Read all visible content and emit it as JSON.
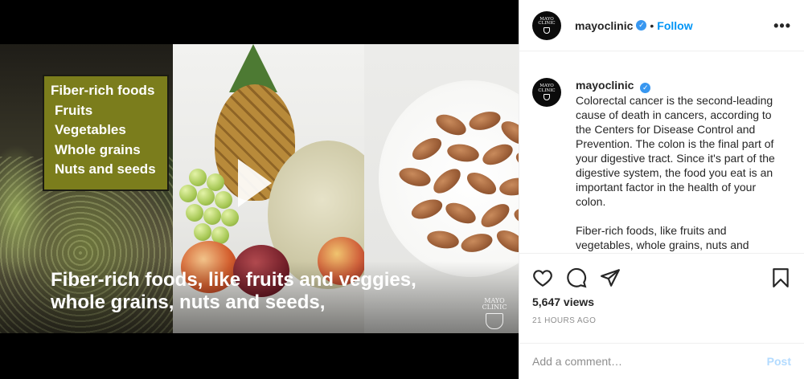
{
  "video": {
    "overlay_list": [
      "Fiber-rich foods",
      "Fruits",
      "Vegetables",
      "Whole grains",
      "Nuts and seeds"
    ],
    "caption_line1": "Fiber-rich foods, like fruits and veggies,",
    "caption_line2": "whole grains, nuts and seeds,",
    "watermark_line1": "MAYO",
    "watermark_line2": "CLINIC"
  },
  "header": {
    "avatar_line1": "MAYO",
    "avatar_line2": "CLINIC",
    "username": "mayoclinic",
    "separator": "•",
    "follow_label": "Follow",
    "more_label": "•••"
  },
  "post": {
    "username": "mayoclinic",
    "caption_p1": "Colorectal cancer is the second-leading cause of death in cancers, according to the Centers for Disease Control and Prevention. The colon is the final part of your digestive tract. Since it's part of the digestive system, the food you eat is an important factor in the health of your colon.",
    "caption_p2": "Fiber-rich foods, like fruits and vegetables, whole grains, nuts and seeds"
  },
  "actions": {
    "views": "5,647 views",
    "timestamp": "21 HOURS AGO"
  },
  "comment_box": {
    "placeholder": "Add a comment…",
    "post_label": "Post"
  },
  "colors": {
    "accent": "#0095f6",
    "verified": "#3897f0",
    "overlay_box": "#7b7d1c"
  },
  "icons": [
    "verified-badge-icon",
    "more-options-icon",
    "heart-icon",
    "comment-icon",
    "share-icon",
    "bookmark-icon",
    "play-icon"
  ]
}
